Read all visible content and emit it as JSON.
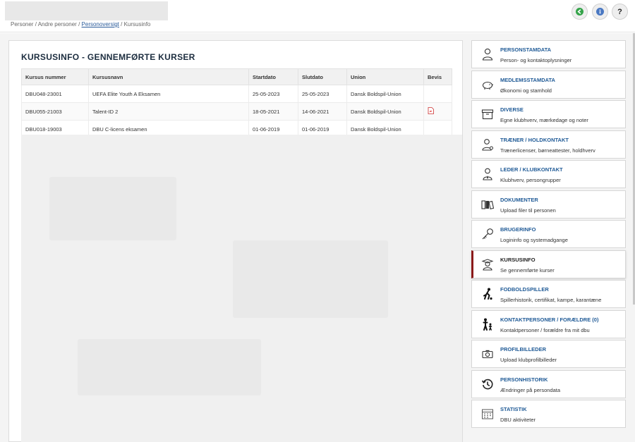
{
  "breadcrumb": {
    "part1": "Personer",
    "sep1": " / ",
    "part2": "Andre personer",
    "sep2": " / ",
    "link": "Personoversigt",
    "sep3": " / ",
    "current": "Kursusinfo"
  },
  "header_buttons": {
    "help_label": "?"
  },
  "main": {
    "title": "KURSUSINFO - GENNEMFØRTE KURSER",
    "columns": [
      "Kursus nummer",
      "Kursusnavn",
      "Startdato",
      "Slutdato",
      "Union",
      "Bevis"
    ],
    "rows": [
      {
        "number": "DBU048-23001",
        "name": "UEFA Elite Youth A Eksamen",
        "start": "25-05-2023",
        "end": "25-05-2023",
        "union": "Dansk Boldspil-Union",
        "has_certificate": false
      },
      {
        "number": "DBU055-21003",
        "name": "Talent-ID 2",
        "start": "18-05-2021",
        "end": "14-06-2021",
        "union": "Dansk Boldspil-Union",
        "has_certificate": true
      },
      {
        "number": "DBU018-19003",
        "name": "DBU C-licens eksamen",
        "start": "01-06-2019",
        "end": "01-06-2019",
        "union": "Dansk Boldspil-Union",
        "has_certificate": false
      }
    ]
  },
  "side_menu": {
    "items": [
      {
        "title": "PERSONSTAMDATA",
        "subtitle": "Person- og kontaktoplysninger",
        "icon": "person-icon"
      },
      {
        "title": "MEDLEMSSTAMDATA",
        "subtitle": "Økonomi og stamhold",
        "icon": "piggy-bank-icon"
      },
      {
        "title": "DIVERSE",
        "subtitle": "Egne klubhverv, mærkedage og noter",
        "icon": "archive-box-icon"
      },
      {
        "title": "TRÆNER / HOLDKONTAKT",
        "subtitle": "Trænerlicenser, børneattester, holdhverv",
        "icon": "coach-icon"
      },
      {
        "title": "LEDER / KLUBKONTAKT",
        "subtitle": "Klubhverv, persongrupper",
        "icon": "leader-icon"
      },
      {
        "title": "DOKUMENTER",
        "subtitle": "Upload filer til personen",
        "icon": "binders-icon"
      },
      {
        "title": "BRUGERINFO",
        "subtitle": "Logininfo og systemadgange",
        "icon": "key-icon"
      },
      {
        "title": "KURSUSINFO",
        "subtitle": "Se gennemførte kurser",
        "icon": "graduate-icon"
      },
      {
        "title": "FODBOLDSPILLER",
        "subtitle": "Spillerhistorik, certifikat, kampe, karantæne",
        "icon": "football-player-icon"
      },
      {
        "title": "KONTAKTPERSONER / FORÆLDRE (0)",
        "subtitle": "Kontaktpersoner / forældre fra mit dbu",
        "icon": "parent-child-icon"
      },
      {
        "title": "PROFILBILLEDER",
        "subtitle": "Upload klubprofilbilleder",
        "icon": "camera-icon"
      },
      {
        "title": "PERSONHISTORIK",
        "subtitle": "Ændringer på persondata",
        "icon": "history-icon"
      },
      {
        "title": "STATISTIK",
        "subtitle": "DBU aktiviteter",
        "icon": "calendar-icon"
      }
    ],
    "active_index": 7
  },
  "colors": {
    "active_accent": "#8b1a1a",
    "link_blue": "#1f5a96",
    "title_dark": "#1c2d3f"
  }
}
